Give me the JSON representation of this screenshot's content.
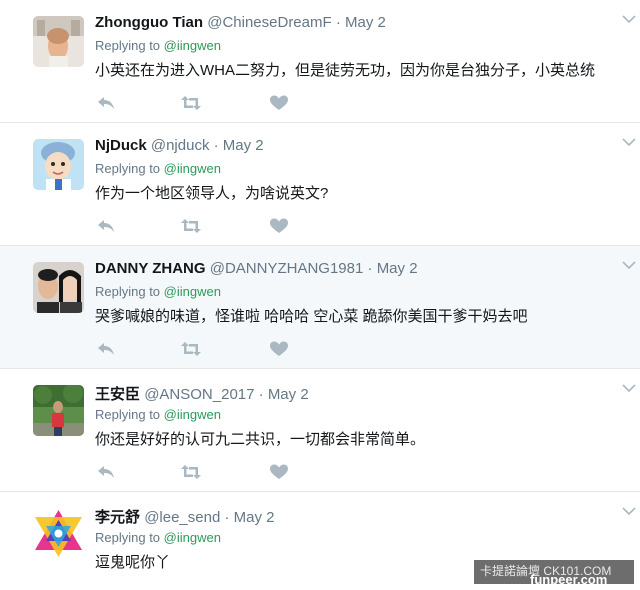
{
  "tweets": [
    {
      "fullname": "Zhongguo Tian",
      "handle": "@ChineseDreamF",
      "dot": "·",
      "date": "May 2",
      "reply_prefix": "Replying to",
      "reply_mention": "@iingwen",
      "text": "小英还在为进入WHA二努力，但是徒劳无功，因为你是台独分子，小英总统",
      "avatar": "profile-photo"
    },
    {
      "fullname": "NjDuck",
      "handle": "@njduck",
      "dot": "·",
      "date": "May 2",
      "reply_prefix": "Replying to",
      "reply_mention": "@iingwen",
      "text": "作为一个地区领导人，为啥说英文?",
      "avatar": "cartoon-character"
    },
    {
      "fullname": "DANNY ZHANG",
      "handle": "@DANNYZHANG1981",
      "dot": "·",
      "date": "May 2",
      "reply_prefix": "Replying to",
      "reply_mention": "@iingwen",
      "text": "哭爹喊娘的味道，怪谁啦 哈哈哈 空心菜 跪舔你美国干爹干妈去吧",
      "avatar": "couple-photo"
    },
    {
      "fullname": "王安臣",
      "handle": "@ANSON_2017",
      "dot": "·",
      "date": "May 2",
      "reply_prefix": "Replying to",
      "reply_mention": "@iingwen",
      "text": "你还是好好的认可九二共识，一切都会非常简单。",
      "avatar": "outdoor-photo"
    },
    {
      "fullname": "李元舒",
      "handle": "@lee_send",
      "dot": "·",
      "date": "May 2",
      "reply_prefix": "Replying to",
      "reply_mention": "@iingwen",
      "text": "逗鬼呢你丫",
      "avatar": "star-pattern"
    }
  ],
  "watermark": {
    "top": "卡提諾論壇 CK101.COM",
    "bottom": "funpeer.com"
  },
  "colors": {
    "highlight_bg": "#f5f8fa",
    "mention": "#2b9a5a",
    "muted": "#657786",
    "icon": "#aab8c2"
  }
}
